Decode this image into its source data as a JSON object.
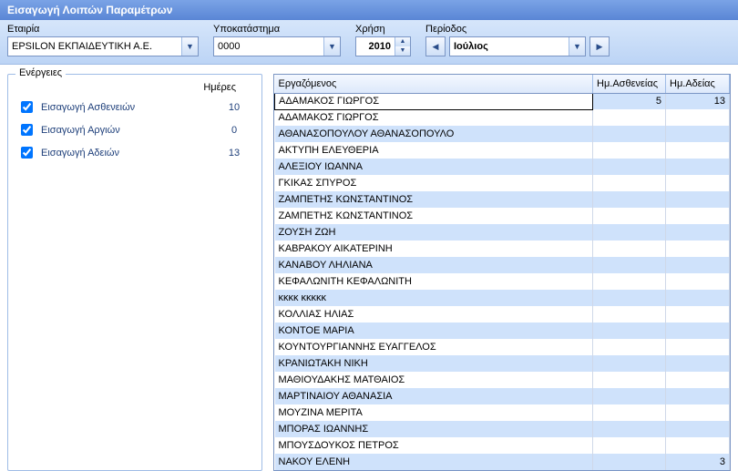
{
  "title": "Εισαγωγή Λοιπών Παραμέτρων",
  "toolbar": {
    "company_label": "Εταιρία",
    "company_value": "EPSILON ΕΚΠΑΙΔΕΥΤΙΚΗ Α.Ε.",
    "branch_label": "Υποκατάστημα",
    "branch_value": "0000",
    "year_label": "Χρήση",
    "year_value": "2010",
    "period_label": "Περίοδος",
    "period_value": "Ιούλιος"
  },
  "actions": {
    "legend": "Ενέργειες",
    "days_header": "Ημέρες",
    "rows": [
      {
        "label": "Εισαγωγή Ασθενειών",
        "days": "10",
        "checked": true
      },
      {
        "label": "Εισαγωγή Αργιών",
        "days": "0",
        "checked": true
      },
      {
        "label": "Εισαγωγή Αδειών",
        "days": "13",
        "checked": true
      }
    ]
  },
  "grid": {
    "headers": {
      "employee": "Εργαζόμενος",
      "sick": "Ημ.Ασθενείας",
      "leave": "Ημ.Αδείας"
    },
    "rows": [
      {
        "name": "ΑΔΑΜΑΚΟΣ ΓΙΩΡΓΟΣ",
        "sick": "5",
        "leave": "13",
        "selected": true
      },
      {
        "name": "ΑΔΑΜΑΚΟΣ ΓΙΩΡΓΟΣ",
        "sick": "",
        "leave": ""
      },
      {
        "name": "ΑΘΑΝΑΣΟΠΟΥΛΟΥ ΑΘΑΝΑΣΟΠΟΥΛΟ",
        "sick": "",
        "leave": ""
      },
      {
        "name": "ΑΚΤΥΠΗ ΕΛΕΥΘΕΡΙΑ",
        "sick": "",
        "leave": ""
      },
      {
        "name": "ΑΛΕΞΙΟΥ ΙΩΑΝΝΑ",
        "sick": "",
        "leave": ""
      },
      {
        "name": "ΓΚΙΚΑΣ ΣΠΥΡΟΣ",
        "sick": "",
        "leave": ""
      },
      {
        "name": "ΖΑΜΠΕΤΗΣ ΚΩΝΣΤΑΝΤΙΝΟΣ",
        "sick": "",
        "leave": ""
      },
      {
        "name": "ΖΑΜΠΕΤΗΣ ΚΩΝΣΤΑΝΤΙΝΟΣ",
        "sick": "",
        "leave": ""
      },
      {
        "name": "ΖΟΥΣΗ ΖΩΗ",
        "sick": "",
        "leave": ""
      },
      {
        "name": "ΚΑΒΡΑΚΟΥ ΑΙΚΑΤΕΡΙΝΗ",
        "sick": "",
        "leave": ""
      },
      {
        "name": "ΚΑΝΑΒΟΥ ΛΗΛΙΑΝΑ",
        "sick": "",
        "leave": ""
      },
      {
        "name": "ΚΕΦΑΛΩΝΙΤΗ ΚΕΦΑΛΩΝΙΤΗ",
        "sick": "",
        "leave": ""
      },
      {
        "name": "κκκκ κκκκκ",
        "sick": "",
        "leave": ""
      },
      {
        "name": "ΚΟΛΛΙΑΣ ΗΛΙΑΣ",
        "sick": "",
        "leave": ""
      },
      {
        "name": "ΚΟΝΤΟΕ ΜΑΡΙΑ",
        "sick": "",
        "leave": ""
      },
      {
        "name": "ΚΟΥΝΤΟΥΡΓΙΑΝΝΗΣ ΕΥΑΓΓΕΛΟΣ",
        "sick": "",
        "leave": ""
      },
      {
        "name": "ΚΡΑΝΙΩΤΑΚΗ ΝΙΚΗ",
        "sick": "",
        "leave": ""
      },
      {
        "name": "ΜΑΘΙΟΥΔΑΚΗΣ ΜΑΤΘΑΙΟΣ",
        "sick": "",
        "leave": ""
      },
      {
        "name": "ΜΑΡΤΙΝΑΙΟΥ ΑΘΑΝΑΣΙΑ",
        "sick": "",
        "leave": ""
      },
      {
        "name": "ΜΟΥΖΙΝΑ ΜΕΡΙΤΑ",
        "sick": "",
        "leave": ""
      },
      {
        "name": "ΜΠΟΡΑΣ ΙΩΑΝΝΗΣ",
        "sick": "",
        "leave": ""
      },
      {
        "name": "ΜΠΟΥΣΔΟΥΚΟΣ ΠΕΤΡΟΣ",
        "sick": "",
        "leave": ""
      },
      {
        "name": "ΝΑΚΟΥ ΕΛΕΝΗ",
        "sick": "",
        "leave": "3"
      }
    ]
  }
}
